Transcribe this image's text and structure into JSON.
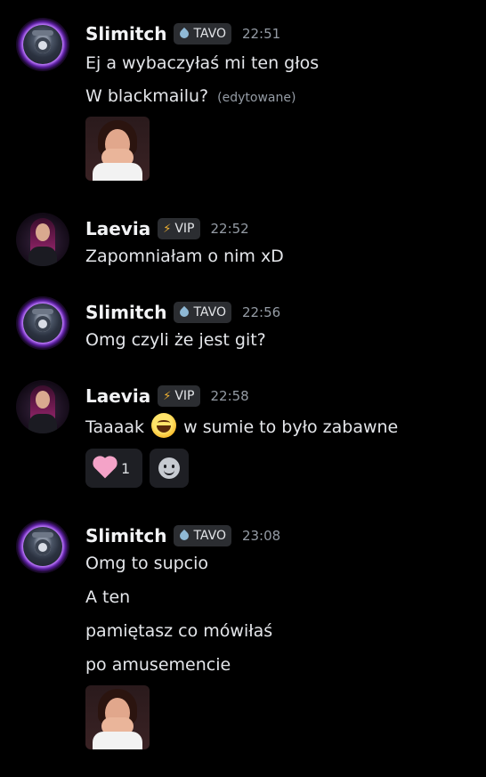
{
  "messages": [
    {
      "user": "Slimitch",
      "tag": "TAVO",
      "tag_icon": "droplet-icon",
      "time": "22:51",
      "lines": [
        "Ej a wybaczyłaś mi ten głos",
        "W blackmailu?"
      ],
      "edited": "(edytowane)",
      "sticker": "crying-woman-sticker"
    },
    {
      "user": "Laevia",
      "tag": "VIP",
      "tag_icon": "lightning-icon",
      "time": "22:52",
      "lines": [
        "Zapomniałam o nim xD"
      ]
    },
    {
      "user": "Slimitch",
      "tag": "TAVO",
      "tag_icon": "droplet-icon",
      "time": "22:56",
      "lines": [
        "Omg czyli że jest git?"
      ]
    },
    {
      "user": "Laevia",
      "tag": "VIP",
      "tag_icon": "lightning-icon",
      "time": "22:58",
      "line_before_emoji": "Taaaak",
      "line_after_emoji": "w sumie to było zabawne",
      "reaction_count": "1"
    },
    {
      "user": "Slimitch",
      "tag": "TAVO",
      "tag_icon": "droplet-icon",
      "time": "23:08",
      "lines": [
        "Omg to supcio",
        "A ten",
        "pamiętasz co mówiłaś",
        "po amusemencie"
      ],
      "sticker": "crying-woman-sticker"
    }
  ],
  "colors": {
    "background": "#000000",
    "username": "#f2f3f5",
    "timestamp": "#949ba4",
    "vip_bolt": "#f0b232",
    "tavo_drop": "#8fb9d6",
    "reaction_heart": "#f4a3c8"
  }
}
